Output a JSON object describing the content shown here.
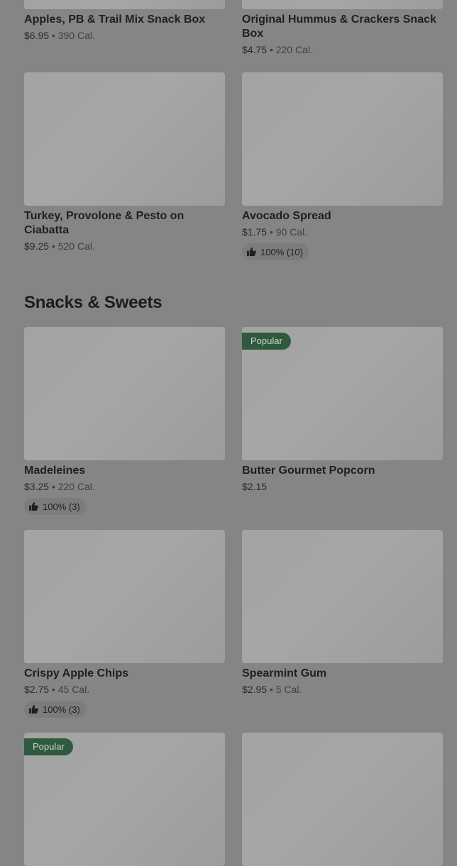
{
  "items_top": [
    {
      "name": "Apples, PB & Trail Mix Snack Box",
      "price": "$6.95",
      "cal": "390 Cal."
    },
    {
      "name": "Original Hummus & Crackers Snack Box",
      "price": "$4.75",
      "cal": "220 Cal."
    },
    {
      "name": "Turkey, Provolone & Pesto on Ciabatta",
      "price": "$9.25",
      "cal": "520 Cal."
    },
    {
      "name": "Avocado Spread",
      "price": "$1.75",
      "cal": "90 Cal.",
      "rating": "100% (10)"
    }
  ],
  "section": {
    "title": "Snacks & Sweets"
  },
  "snacks": [
    {
      "name": "Madeleines",
      "price": "$3.25",
      "cal": "220 Cal.",
      "rating": "100% (3)"
    },
    {
      "name": "Butter Gourmet Popcorn",
      "price": "$2.15",
      "badge": "Popular"
    },
    {
      "name": "Crispy Apple Chips",
      "price": "$2.75",
      "cal": "45 Cal.",
      "rating": "100% (3)"
    },
    {
      "name": "Spearmint Gum",
      "price": "$2.95",
      "cal": "5 Cal."
    },
    {
      "badge": "Popular"
    }
  ],
  "separator": "•",
  "icons": {
    "rating": "thumbs-up-icon"
  },
  "colors": {
    "badge_bg": "#2f5a3d",
    "badge_text": "#c8d7cc",
    "rating_bg": "#7c7c7c"
  }
}
